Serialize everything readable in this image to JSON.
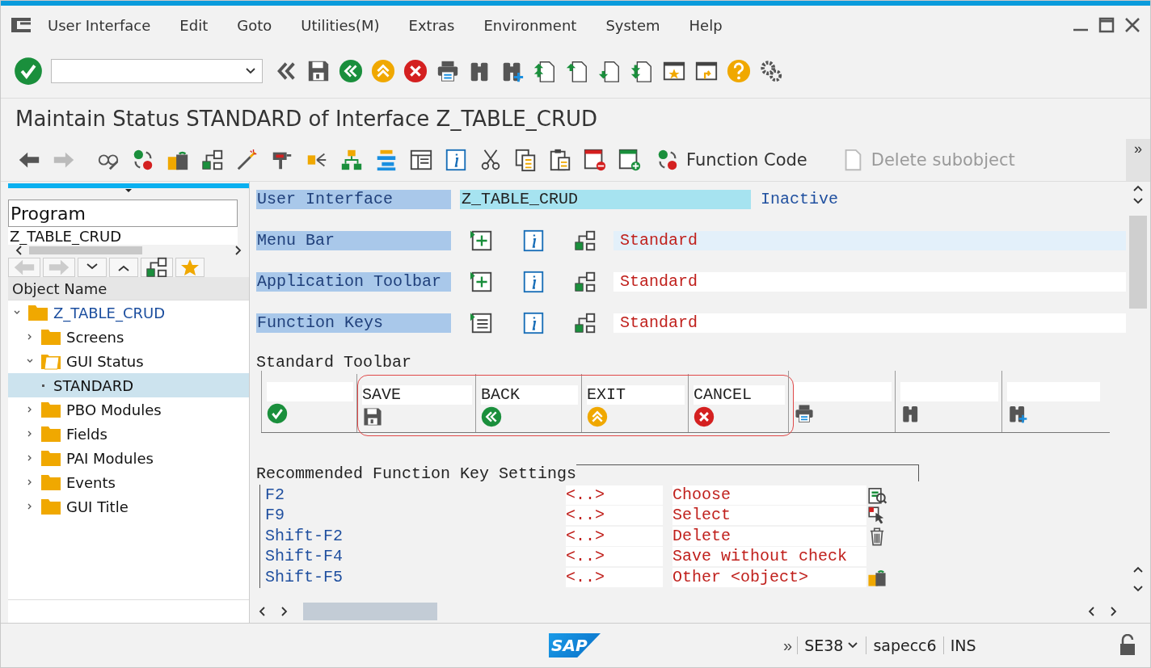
{
  "menu_bar": {
    "items": [
      "User Interface",
      "Edit",
      "Goto",
      "Utilities(M)",
      "Extras",
      "Environment",
      "System",
      "Help"
    ]
  },
  "title": "Maintain Status STANDARD of Interface Z_TABLE_CRUD",
  "app_toolbar": {
    "buttons": [
      {
        "label": "Function Code",
        "disabled": false
      },
      {
        "label": "Delete subobject",
        "disabled": true
      }
    ],
    "overflow": "»"
  },
  "navigator": {
    "object_type": "Program",
    "object_name": "Z_TABLE_CRUD",
    "column_header": "Object Name",
    "tree": [
      {
        "label": "Z_TABLE_CRUD",
        "expanded": true,
        "selected": false,
        "children": [
          {
            "label": "Screens",
            "expanded": false,
            "selected": false
          },
          {
            "label": "GUI Status",
            "expanded": true,
            "selected": false,
            "children": [
              {
                "label": "STANDARD",
                "selected": true
              }
            ]
          },
          {
            "label": "PBO Modules",
            "expanded": false,
            "selected": false
          },
          {
            "label": "Fields",
            "expanded": false,
            "selected": false
          },
          {
            "label": "PAI Modules",
            "expanded": false,
            "selected": false
          },
          {
            "label": "Events",
            "expanded": false,
            "selected": false
          },
          {
            "label": "GUI Title",
            "expanded": false,
            "selected": false
          }
        ]
      }
    ]
  },
  "interface": {
    "label": "User Interface",
    "value": "Z_TABLE_CRUD",
    "status": "Inactive"
  },
  "components": [
    {
      "label": "Menu Bar",
      "value": "Standard",
      "selected": true
    },
    {
      "label": "Application Toolbar",
      "value": "Standard",
      "selected": false
    },
    {
      "label": "Function Keys",
      "value": "Standard",
      "selected": false
    }
  ],
  "standard_toolbar": {
    "title": "Standard Toolbar",
    "groups": [
      {
        "highlighted": false,
        "cells": [
          {
            "blank": true
          }
        ]
      },
      {
        "highlighted": true,
        "cells": [
          {
            "function": "SAVE"
          },
          {
            "function": "BACK"
          },
          {
            "function": "EXIT"
          },
          {
            "function": "CANCEL"
          }
        ]
      },
      {
        "highlighted": false,
        "cells": [
          {
            "blank": true
          },
          {
            "blank": true
          },
          {
            "blank": true
          }
        ]
      }
    ]
  },
  "function_keys": {
    "title": "Recommended Function Key Settings",
    "rows": [
      {
        "key": "F2",
        "code": "<..>",
        "text": "Choose"
      },
      {
        "key": "F9",
        "code": "<..>",
        "text": "Select"
      },
      {
        "key": "Shift-F2",
        "code": "<..>",
        "text": "Delete"
      },
      {
        "key": "Shift-F4",
        "code": "<..>",
        "text": "Save without check"
      },
      {
        "key": "Shift-F5",
        "code": "<..>",
        "text": "Other <object>"
      }
    ]
  },
  "status_bar": {
    "logo": "SAP",
    "overflow": "»",
    "transaction": "SE38",
    "system": "sapecc6",
    "mode": "INS"
  }
}
